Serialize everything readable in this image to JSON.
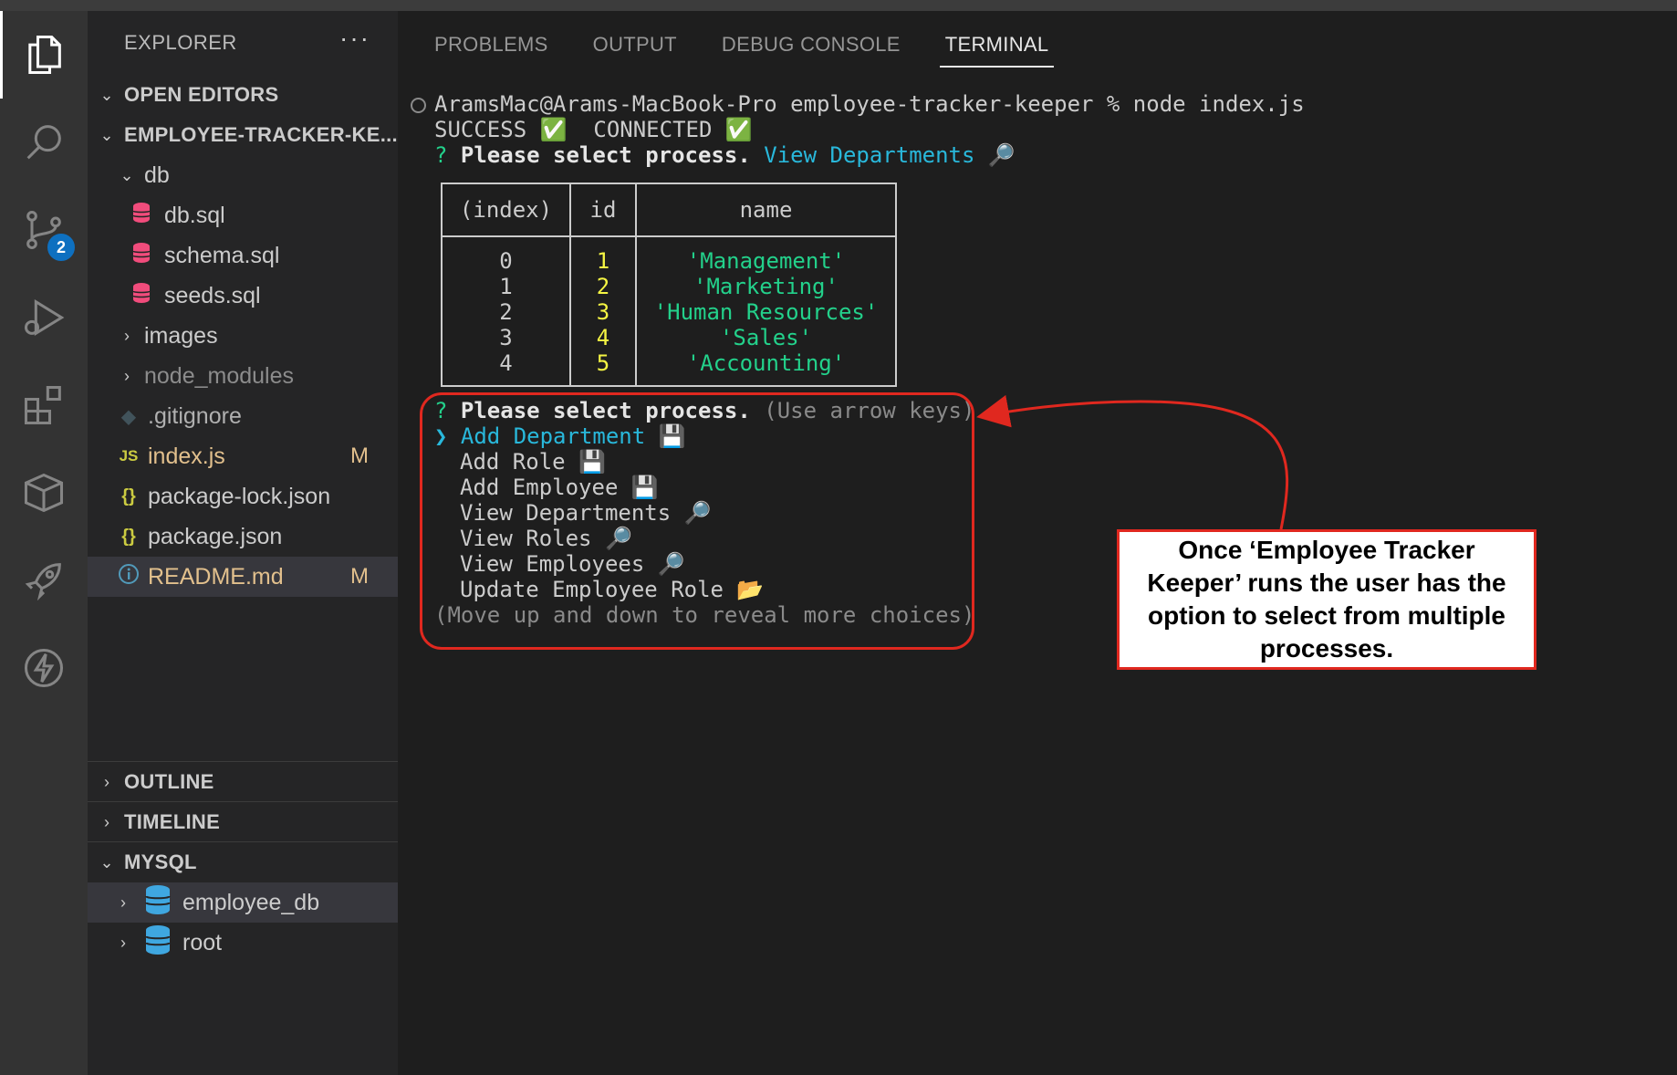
{
  "sidebar": {
    "header": "EXPLORER",
    "more": "···",
    "open_editors": "OPEN EDITORS",
    "project": "EMPLOYEE-TRACKER-KE...",
    "tree": [
      {
        "label": "db",
        "type": "folder-open"
      },
      {
        "label": "db.sql",
        "type": "sql"
      },
      {
        "label": "schema.sql",
        "type": "sql"
      },
      {
        "label": "seeds.sql",
        "type": "sql"
      },
      {
        "label": "images",
        "type": "folder"
      },
      {
        "label": "node_modules",
        "type": "folder"
      },
      {
        "label": ".gitignore",
        "type": "git"
      },
      {
        "label": "index.js",
        "type": "js",
        "status": "M"
      },
      {
        "label": "package-lock.json",
        "type": "json"
      },
      {
        "label": "package.json",
        "type": "json"
      },
      {
        "label": "README.md",
        "type": "info",
        "status": "M"
      }
    ],
    "outline": "OUTLINE",
    "timeline": "TIMELINE",
    "mysql": "MYSQL",
    "mysql_items": [
      "employee_db",
      "root"
    ]
  },
  "activity": {
    "scm_badge": "2"
  },
  "panel": {
    "tabs": [
      "PROBLEMS",
      "OUTPUT",
      "DEBUG CONSOLE",
      "TERMINAL"
    ],
    "active_tab": "TERMINAL"
  },
  "terminal": {
    "prompt_line": "AramsMac@Arams-MacBook-Pro employee-tracker-keeper % node index.js",
    "success_line": "SUCCESS ✅  CONNECTED ✅",
    "q_mark": "?",
    "select_prompt": "Please select process.",
    "selected_answer": "View Departments 🔎",
    "table": {
      "headers": [
        "(index)",
        "id",
        "name"
      ],
      "index": [
        "0",
        "1",
        "2",
        "3",
        "4"
      ],
      "id": [
        "1",
        "2",
        "3",
        "4",
        "5"
      ],
      "name": [
        "'Management'",
        "'Marketing'",
        "'Human Resources'",
        "'Sales'",
        "'Accounting'"
      ]
    },
    "hint": "(Use arrow keys)",
    "pointer": "❯",
    "choices": [
      "Add Department 💾",
      "Add Role 💾",
      "Add Employee 💾",
      "View Departments 🔎",
      "View Roles 🔎",
      "View Employees 🔎",
      "Update Employee Role 📂"
    ],
    "more_hint": "(Move up and down to reveal more choices)"
  },
  "annotation": {
    "text": "Once ‘Employee Tracker Keeper’ runs the user has the option to select from multiple processes.",
    "color": "#e0281f"
  },
  "colors": {
    "accent_green": "#23d18b",
    "accent_cyan": "#29b8db",
    "accent_yellow": "#f5f543",
    "modified": "#e2c08d"
  }
}
